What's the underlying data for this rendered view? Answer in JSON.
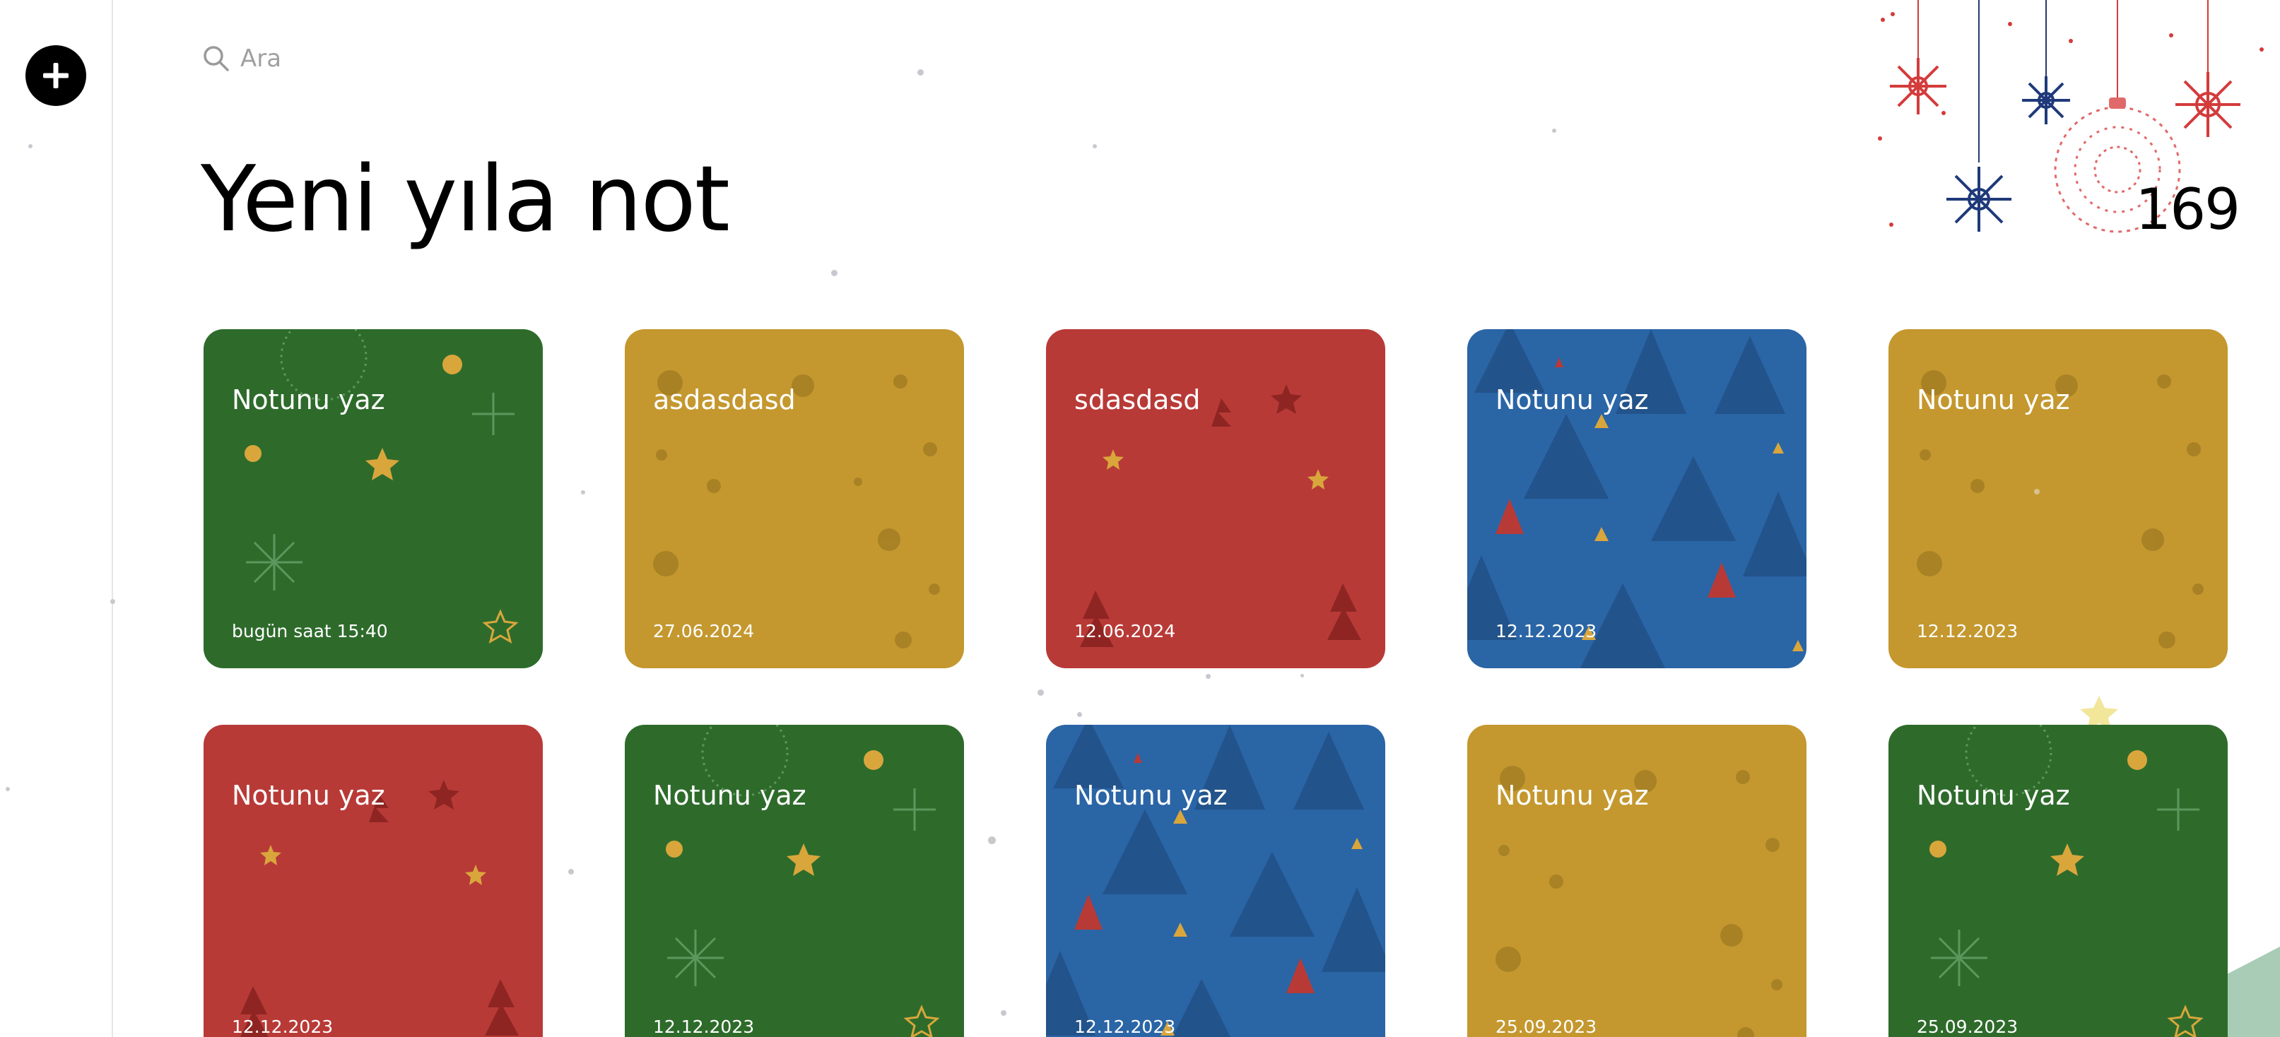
{
  "search": {
    "placeholder": "Ara",
    "icon": "search-icon"
  },
  "page": {
    "title": "Yeni yıla not",
    "count": "169"
  },
  "actions": {
    "add_icon": "plus-icon"
  },
  "colors": {
    "green": "#2e6b2b",
    "gold": "#c4982f",
    "red": "#b83a37",
    "blue": "#2a65a6"
  },
  "notes": [
    {
      "title": "Notunu yaz",
      "date": "bugün saat 15:40",
      "theme": "green"
    },
    {
      "title": "asdasdasd",
      "date": "27.06.2024",
      "theme": "gold"
    },
    {
      "title": "sdasdasd",
      "date": "12.06.2024",
      "theme": "red"
    },
    {
      "title": "Notunu yaz",
      "date": "12.12.2023",
      "theme": "blue"
    },
    {
      "title": "Notunu yaz",
      "date": "12.12.2023",
      "theme": "gold"
    },
    {
      "title": "Notunu yaz",
      "date": "12.12.2023",
      "theme": "red"
    },
    {
      "title": "Notunu yaz",
      "date": "12.12.2023",
      "theme": "green"
    },
    {
      "title": "Notunu yaz",
      "date": "12.12.2023",
      "theme": "blue"
    },
    {
      "title": "Notunu yaz",
      "date": "25.09.2023",
      "theme": "gold"
    },
    {
      "title": "Notunu yaz",
      "date": "25.09.2023",
      "theme": "green"
    }
  ]
}
